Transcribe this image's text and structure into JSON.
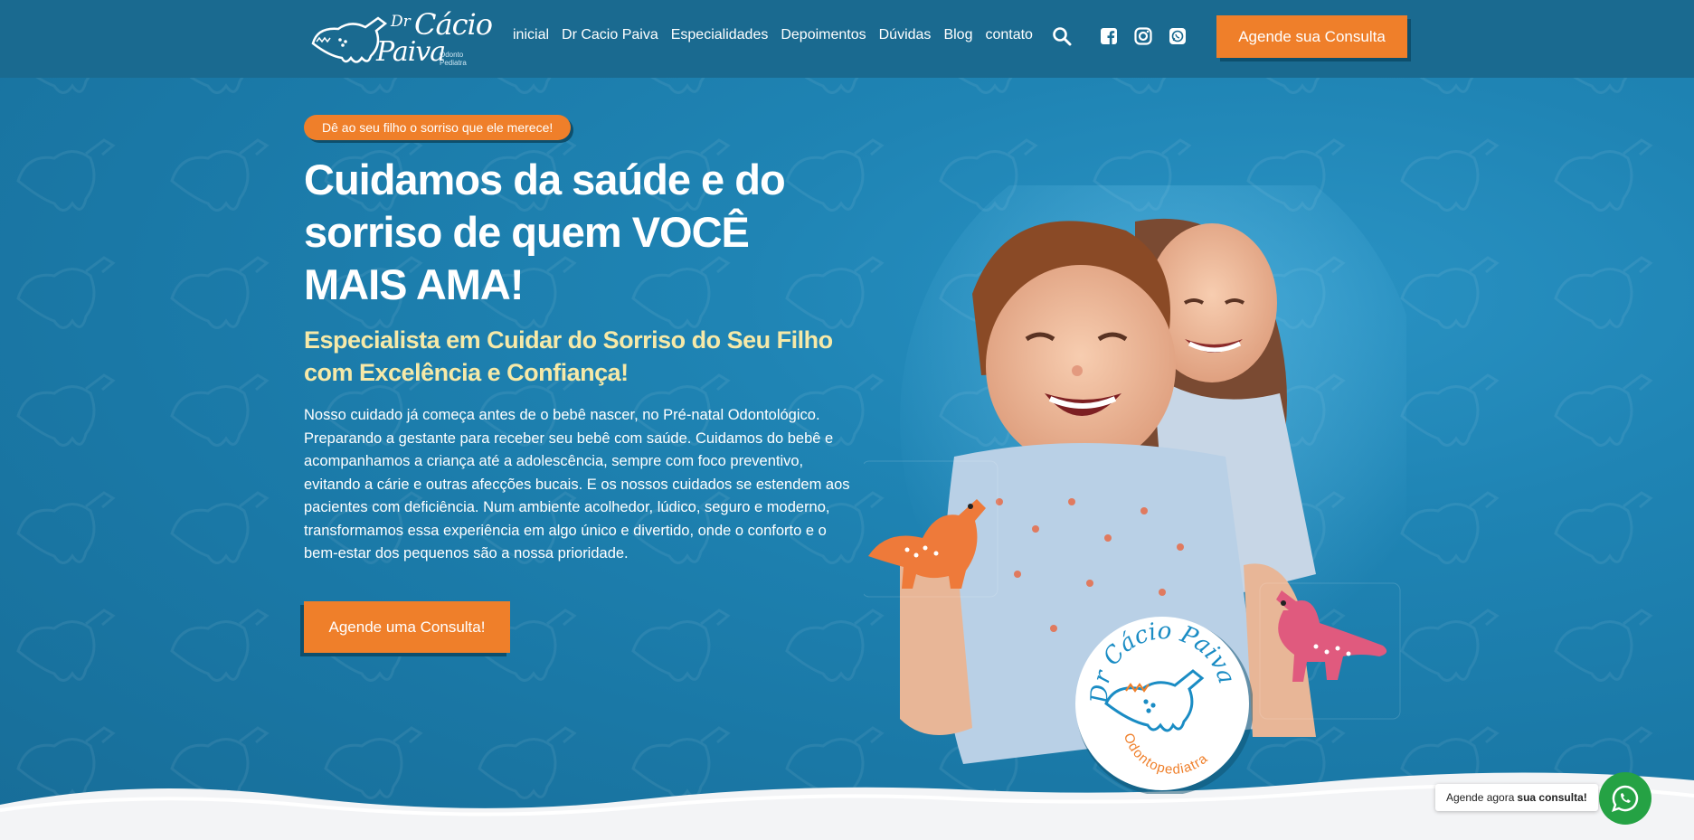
{
  "header": {
    "logo": {
      "dr": "Dr",
      "cacio": "Cácio",
      "paiva": "Paiva",
      "sub1": "Odonto",
      "sub2": "Pediatra"
    },
    "nav": [
      "inicial",
      "Dr Cacio Paiva",
      "Especialidades",
      "Depoimentos",
      "Dúvidas",
      "Blog",
      "contato"
    ],
    "icons": [
      "search-icon",
      "facebook-icon",
      "instagram-icon",
      "whatsapp-icon"
    ],
    "cta": "Agende sua Consulta"
  },
  "hero": {
    "pill": "Dê ao seu filho o sorriso que ele merece!",
    "headline": "Cuidamos da saúde e do sorriso de quem VOCÊ MAIS AMA!",
    "subheadline": "Especialista em Cuidar do Sorriso do Seu Filho com Excelência e Confiança!",
    "paragraph": "Nosso cuidado já começa antes de o bebê nascer, no Pré-natal Odontológico. Preparando a gestante para receber seu bebê com saúde. Cuidamos do bebê e acompanhamos a criança até a adolescência, sempre com foco preventivo, evitando a cárie e outras afecções bucais. E os nossos cuidados se estendem aos pacientes com deficiência. Num ambiente acolhedor, lúdico, seguro e moderno, transformamos essa experiência em algo único e divertido, onde o conforto e o bem-estar dos pequenos são a nossa prioridade.",
    "cta": "Agende uma Consulta!"
  },
  "badge": {
    "top": "Dr Cácio Paiva",
    "bottom": "Odontopediatra"
  },
  "whatsapp": {
    "tip_prefix": "Agende agora",
    "tip_bold": "sua consulta!"
  },
  "colors": {
    "primary": "#1a78a6",
    "header": "#1a6a90",
    "accent": "#ef7f2a",
    "subheadline": "#f6e9a8",
    "whatsapp": "#25a244"
  }
}
